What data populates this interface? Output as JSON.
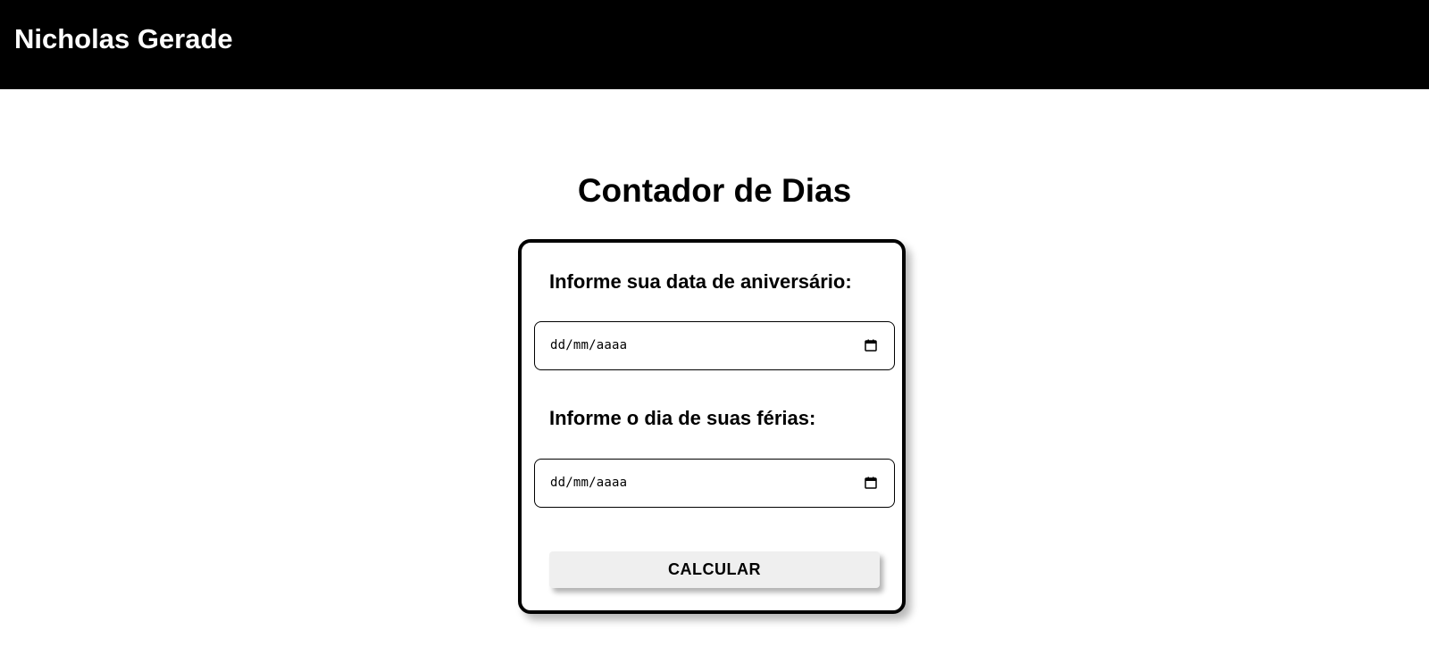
{
  "header": {
    "brand": "Nicholas Gerade"
  },
  "main": {
    "title": "Contador de Dias",
    "form": {
      "birthday": {
        "label": "Informe sua data de aniversário:",
        "placeholder": "dd/mm/aaaa",
        "icon": "calendar-icon"
      },
      "vacation": {
        "label": "Informe o dia de suas férias:",
        "placeholder": "dd/mm/aaaa",
        "icon": "calendar-icon"
      },
      "submit_label": "CALCULAR"
    }
  },
  "colors": {
    "header_bg": "#000000",
    "header_text": "#ffffff",
    "button_bg": "#efefef",
    "card_border": "#000000"
  }
}
